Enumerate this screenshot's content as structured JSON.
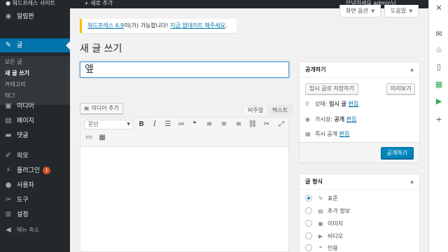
{
  "admin_bar": {
    "site_name": "● 워드프레스 사이트",
    "new_label": "+ 새로 추가",
    "greeting": "안녕하세요 admin님"
  },
  "menu": {
    "items": [
      {
        "key": "dashboard",
        "icon": "dashboard-icon",
        "glyph": "◉",
        "label": "알림판"
      },
      {
        "key": "posts",
        "icon": "pin-icon",
        "glyph": "✎",
        "label": "글"
      },
      {
        "key": "media",
        "icon": "media-icon",
        "glyph": "▣",
        "label": "미디어"
      },
      {
        "key": "pages",
        "icon": "page-icon",
        "glyph": "▤",
        "label": "페이지"
      },
      {
        "key": "comments",
        "icon": "comment-icon",
        "glyph": "▬",
        "label": "댓글"
      },
      {
        "key": "appearance",
        "icon": "brush-icon",
        "glyph": "✐",
        "label": "외모"
      },
      {
        "key": "plugins",
        "icon": "plugin-icon",
        "glyph": "⚡",
        "label": "플러그인",
        "badge": "1"
      },
      {
        "key": "users",
        "icon": "user-icon",
        "glyph": "●",
        "label": "사용자"
      },
      {
        "key": "tools",
        "icon": "wrench-icon",
        "glyph": "✂",
        "label": "도구"
      },
      {
        "key": "settings",
        "icon": "settings-icon",
        "glyph": "⊞",
        "label": "설정"
      },
      {
        "key": "collapse",
        "icon": "collapse-icon",
        "glyph": "◀",
        "label": "메뉴 축소"
      }
    ],
    "submenu": [
      "모든 글",
      "새 글 쓰기",
      "카테고리",
      "태그"
    ]
  },
  "screen_options": {
    "screen_options_label": "화면 옵션",
    "help_label": "도움말"
  },
  "notice": {
    "version_link": "워드프레스 4.9",
    "middle_text": "이(가) 가능합니다! ",
    "update_link": "지금 업데이트 해주세요",
    "end_text": "."
  },
  "page_title": "새 글 쓰기",
  "title_value": "앺",
  "editor": {
    "add_media_label": "미디어 추가",
    "tab_visual": "비주얼",
    "tab_text": "텍스트",
    "format_select": "문단",
    "toolbar": [
      {
        "icon": "bold-icon",
        "glyph": "B"
      },
      {
        "icon": "italic-icon",
        "glyph": "I"
      },
      {
        "icon": "bullet-list-icon",
        "glyph": "☰"
      },
      {
        "icon": "numbered-list-icon",
        "glyph": "≔"
      },
      {
        "icon": "blockquote-icon",
        "glyph": "❝"
      },
      {
        "icon": "align-left-icon",
        "glyph": "≡"
      },
      {
        "icon": "align-center-icon",
        "glyph": "≡"
      },
      {
        "icon": "align-right-icon",
        "glyph": "≡"
      },
      {
        "icon": "link-icon",
        "glyph": "⛓"
      },
      {
        "icon": "unlink-icon",
        "glyph": "✂"
      },
      {
        "icon": "fullscreen-icon",
        "glyph": "⤢"
      }
    ],
    "toolbar2": [
      {
        "icon": "insert-more-icon",
        "glyph": "▭"
      },
      {
        "icon": "toolbar-toggle-icon",
        "glyph": "▦"
      }
    ]
  },
  "publish_box": {
    "title": "공개하기",
    "save_draft": "임시 글로 저장하기",
    "preview": "미리보기",
    "status_label": "상태: ",
    "status_value": "임시 글",
    "visibility_label": "가시성: ",
    "visibility_value": "공개",
    "schedule_label": "즉시 공개",
    "edit_link": "편집",
    "publish_button": "공개하기"
  },
  "format_box": {
    "title": "글 형식",
    "options": [
      {
        "label": "표준",
        "icon": "pin-icon",
        "glyph": "✎",
        "checked": true
      },
      {
        "label": "추가 정보",
        "icon": "aside-icon",
        "glyph": "▤",
        "checked": false
      },
      {
        "label": "이미지",
        "icon": "image-icon",
        "glyph": "▣",
        "checked": false
      },
      {
        "label": "비디오",
        "icon": "video-icon",
        "glyph": "▶",
        "checked": false
      },
      {
        "label": "인용",
        "icon": "quote-icon",
        "glyph": "❝",
        "checked": false
      }
    ]
  },
  "browser_strip": [
    {
      "icon": "close-icon",
      "glyph": "✕"
    },
    {
      "icon": "mail-icon",
      "glyph": "✉"
    },
    {
      "icon": "star-icon",
      "glyph": "☆"
    },
    {
      "icon": "document-icon",
      "glyph": "▯"
    },
    {
      "icon": "sheet-icon",
      "glyph": "▦"
    },
    {
      "icon": "play-icon",
      "glyph": "▶"
    },
    {
      "icon": "add-icon",
      "glyph": "+"
    }
  ]
}
